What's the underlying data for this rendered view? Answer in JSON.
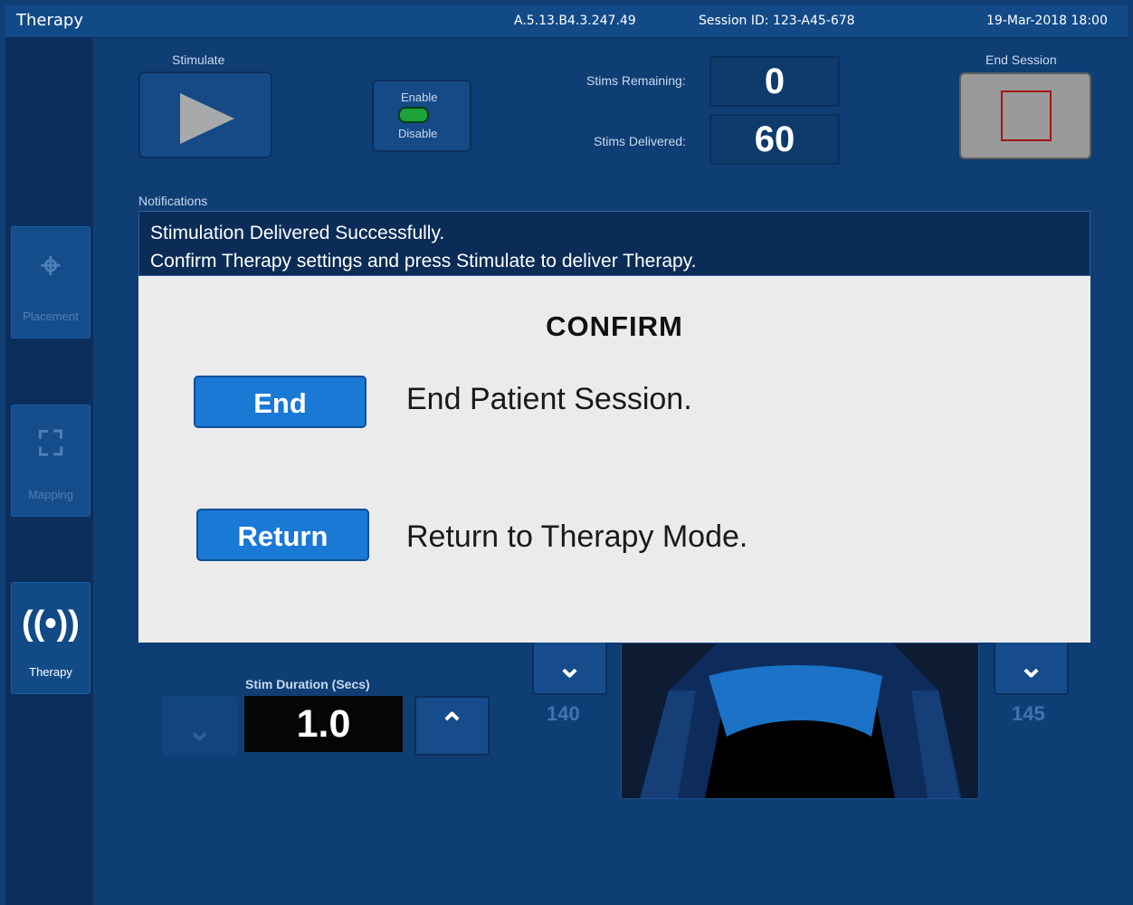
{
  "topbar": {
    "title": "Therapy",
    "version": "A.5.13.B4.3.247.49",
    "session": "Session ID: 123-A45-678",
    "datetime": "19-Mar-2018  18:00"
  },
  "nav": {
    "placement": "Placement",
    "mapping": "Mapping",
    "therapy": "Therapy"
  },
  "controls": {
    "stimulate": "Stimulate",
    "enable": "Enable",
    "disable": "Disable",
    "stims_remaining_label": "Stims Remaining:",
    "stims_remaining_value": "0",
    "stims_delivered_label": "Stims Delivered:",
    "stims_delivered_value": "60",
    "end_session": "End Session",
    "notifications_label": "Notifications",
    "notification_line_1": "Stimulation Delivered Successfully.",
    "notification_line_2": "Confirm Therapy settings and press Stimulate to deliver Therapy."
  },
  "modal": {
    "title": "CONFIRM",
    "end_button": "End",
    "end_text": "End Patient Session.",
    "return_button": "Return",
    "return_text": "Return to Therapy Mode."
  },
  "bottom": {
    "stim_duration_label": "Stim Duration (Secs)",
    "stim_duration_value": "1.0",
    "left_value": "140",
    "right_value": "145"
  },
  "icons": {
    "play": "play-icon",
    "stop": "stop-icon",
    "target": "target-icon",
    "focus": "focus-icon",
    "broadcast": "broadcast-icon",
    "chevron_down": "chevron-down-icon",
    "chevron_up": "chevron-up-icon"
  },
  "colors": {
    "background": "#0f3e74",
    "modal_button": "#1b79d6",
    "toggle_on": "#1ea23b",
    "stop_square": "#a31515"
  }
}
